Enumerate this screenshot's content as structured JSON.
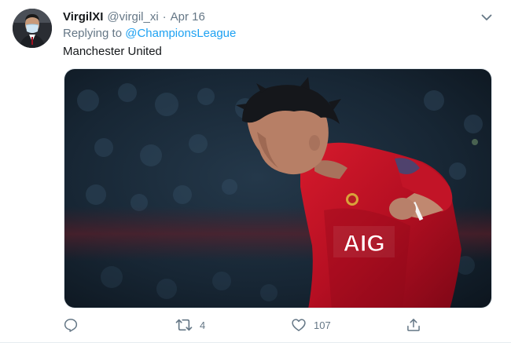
{
  "tweet": {
    "display_name": "VirgilXI",
    "handle": "@virgil_xi",
    "separator": "·",
    "date": "Apr 16",
    "replying_prefix": "Replying to ",
    "replying_to": "@ChampionsLeague",
    "text": "Manchester United",
    "media_shirt_text": "AIG"
  },
  "actions": {
    "reply_icon": "reply-icon",
    "retweet_icon": "retweet-icon",
    "retweet_count": "4",
    "like_icon": "heart-icon",
    "like_count": "107",
    "share_icon": "share-icon"
  },
  "colors": {
    "link": "#1da1f2",
    "secondary_text": "#657786",
    "jersey_red": "#c8102e"
  }
}
